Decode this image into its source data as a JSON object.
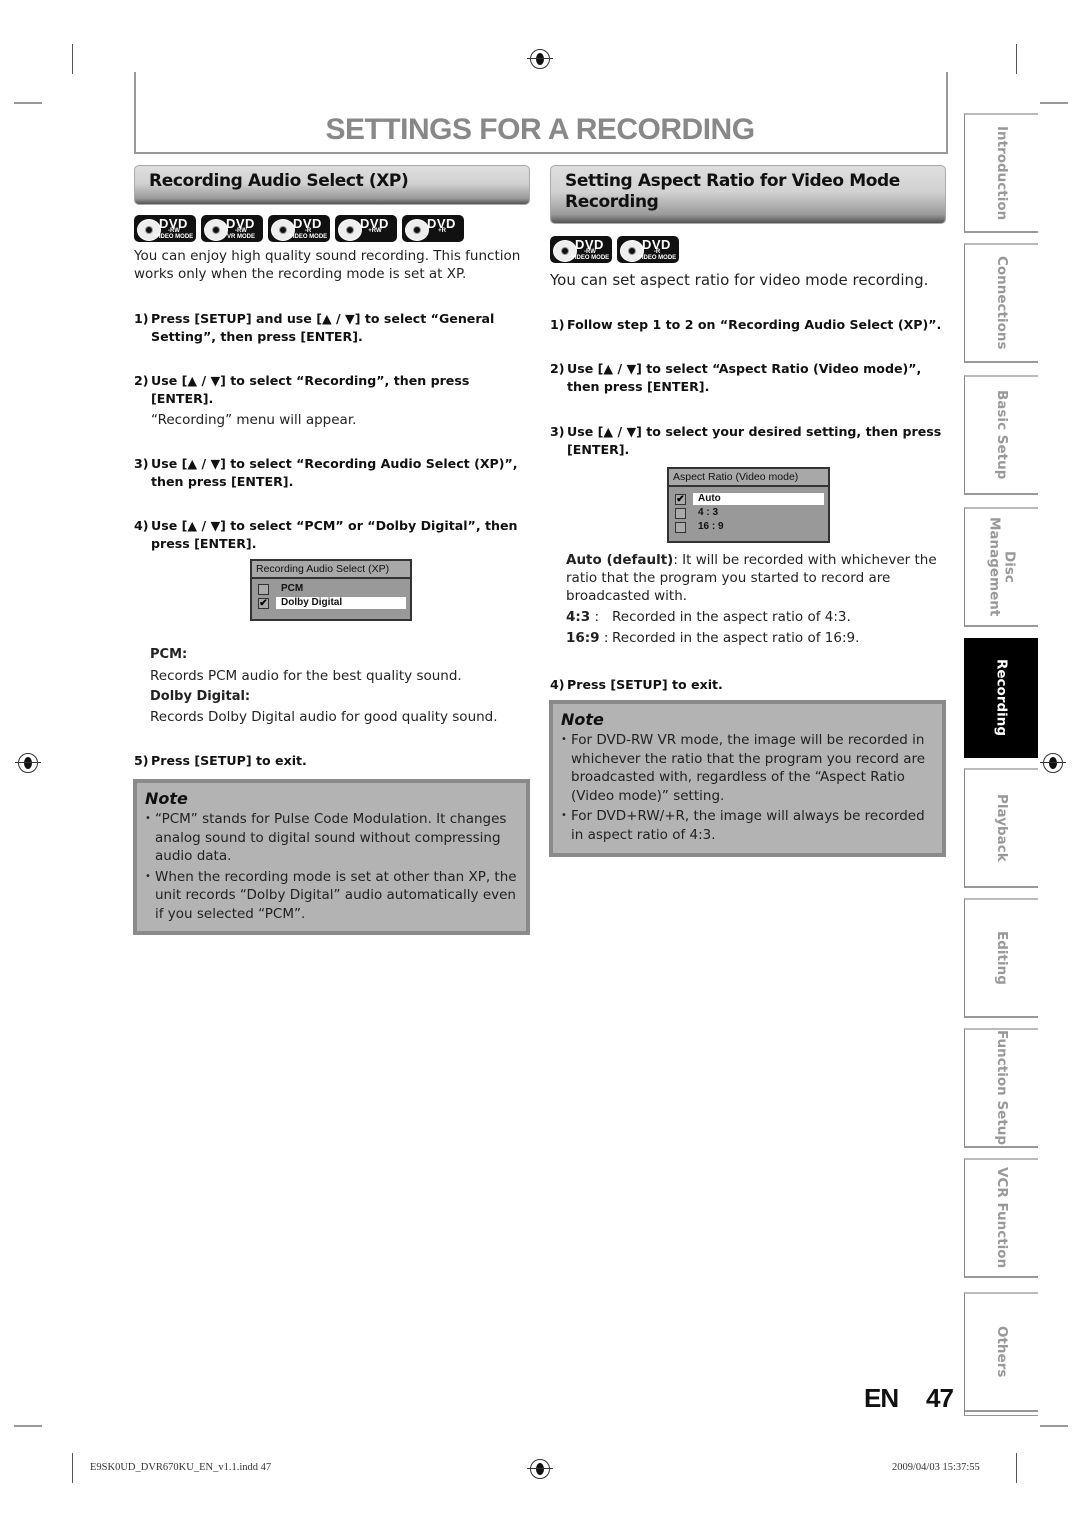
{
  "page": {
    "title": "SETTINGS FOR A RECORDING",
    "page_lang": "EN",
    "page_number": "47"
  },
  "left_section": {
    "heading": "Recording Audio Select (XP)",
    "badges": [
      {
        "label": "DVD",
        "sub1": "-RW",
        "sub2": "VIDEO MODE"
      },
      {
        "label": "DVD",
        "sub1": "-RW",
        "sub2": "VR MODE"
      },
      {
        "label": "DVD",
        "sub1": "-R",
        "sub2": "VIDEO MODE"
      },
      {
        "label": "DVD",
        "sub1": "+RW",
        "sub2": ""
      },
      {
        "label": "DVD",
        "sub1": "+R",
        "sub2": ""
      }
    ],
    "intro": "You can enjoy high quality sound recording. This function works only when the recording mode is set at XP.",
    "steps": [
      {
        "num": "1)",
        "text": "Press [SETUP] and use [▲ / ▼] to select “General Setting”, then press [ENTER]."
      },
      {
        "num": "2)",
        "text": "Use [▲ / ▼] to select “Recording”, then press [ENTER]."
      },
      {
        "num": "3)",
        "text": "Use [▲ / ▼] to select “Recording Audio Select (XP)”, then press [ENTER]."
      },
      {
        "num": "4)",
        "text": "Use [▲ / ▼] to select “PCM” or “Dolby Digital”, then press [ENTER]."
      },
      {
        "num": "5)",
        "text": "Press [SETUP] to exit."
      }
    ],
    "step2_sub": "“Recording” menu will appear.",
    "menu": {
      "title": "Recording Audio Select (XP)",
      "options": [
        {
          "label": "PCM",
          "checked": false,
          "mark": ""
        },
        {
          "label": "Dolby Digital",
          "checked": true,
          "mark": "✔"
        }
      ]
    },
    "defs": [
      {
        "term": "PCM:",
        "desc": "Records PCM audio for the best quality sound."
      },
      {
        "term": "Dolby Digital:",
        "desc": "Records Dolby Digital audio for good quality sound."
      }
    ],
    "note": {
      "title": "Note",
      "items": [
        "“PCM” stands for Pulse Code Modulation. It changes analog sound to digital sound without compressing audio data.",
        "When the recording mode is set at other than XP, the unit records “Dolby Digital” audio automatically even if you selected “PCM”."
      ]
    }
  },
  "right_section": {
    "heading": "Setting Aspect Ratio for Video Mode Recording",
    "badges": [
      {
        "label": "DVD",
        "sub1": "-RW",
        "sub2": "VIDEO MODE"
      },
      {
        "label": "DVD",
        "sub1": "-R",
        "sub2": "VIDEO MODE"
      }
    ],
    "intro": "You can set aspect ratio for video mode recording.",
    "steps": [
      {
        "num": "1)",
        "text": "Follow step 1 to 2 on “Recording Audio Select (XP)”."
      },
      {
        "num": "2)",
        "text": "Use [▲ / ▼] to select “Aspect Ratio (Video mode)”, then press [ENTER]."
      },
      {
        "num": "3)",
        "text": "Use [▲ / ▼] to select your desired setting, then press [ENTER]."
      },
      {
        "num": "4)",
        "text": "Press [SETUP] to exit."
      }
    ],
    "menu": {
      "title": "Aspect Ratio (Video mode)",
      "options": [
        {
          "label": "Auto",
          "checked": true,
          "mark": "✔"
        },
        {
          "label": "4 : 3",
          "checked": false,
          "mark": ""
        },
        {
          "label": "16 : 9",
          "checked": false,
          "mark": ""
        }
      ]
    },
    "defs": [
      {
        "term": "Auto (default)",
        "desc": ": It will be recorded with whichever the ratio that the program you started to record are broadcasted with."
      },
      {
        "term": "4:3",
        "desc": "Recorded in the aspect ratio of 4:3."
      },
      {
        "term": "16:9",
        "desc": "Recorded in the aspect ratio of 16:9."
      }
    ],
    "def_sep": " :",
    "note": {
      "title": "Note",
      "items": [
        "For DVD-RW VR mode, the image will be recorded in whichever the ratio that the program you record are broadcasted with, regardless of the “Aspect Ratio (Video mode)” setting.",
        "For DVD+RW/+R, the image will always be recorded in aspect ratio of 4:3."
      ]
    }
  },
  "side_tabs": [
    {
      "label": "Introduction",
      "active": false
    },
    {
      "label": "Connections",
      "active": false
    },
    {
      "label": "Basic Setup",
      "active": false
    },
    {
      "label": "Disc Management",
      "active": false
    },
    {
      "label": "Recording",
      "active": true
    },
    {
      "label": "Playback",
      "active": false
    },
    {
      "label": "Editing",
      "active": false
    },
    {
      "label": "Function Setup",
      "active": false
    },
    {
      "label": "VCR Function",
      "active": false
    },
    {
      "label": "Others",
      "active": false
    }
  ],
  "footer": {
    "file": "E9SK0UD_DVR670KU_EN_v1.1.indd   47",
    "timestamp": "2009/04/03   15:37:55"
  }
}
